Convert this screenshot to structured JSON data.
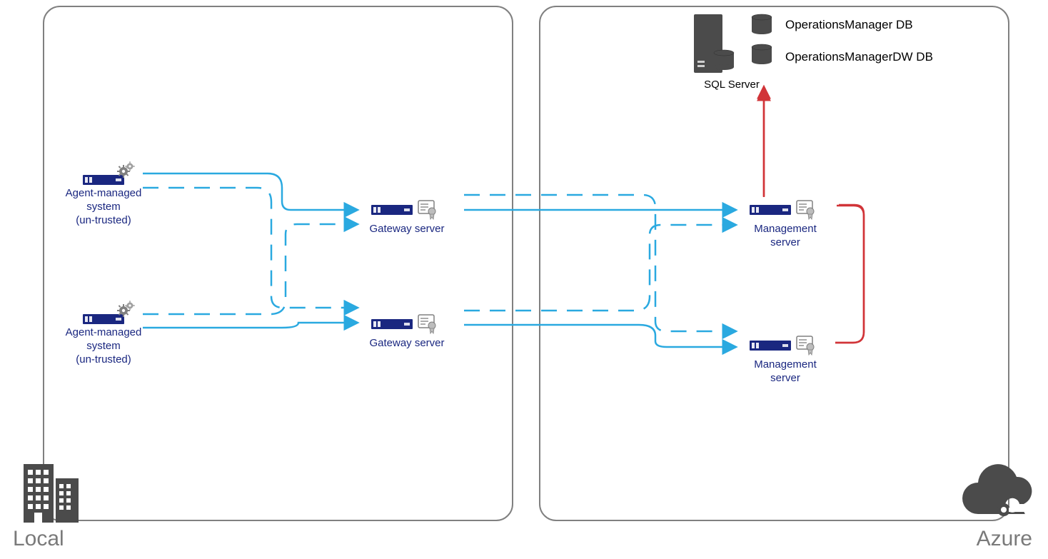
{
  "regions": {
    "local": {
      "label": "Local"
    },
    "azure": {
      "label": "Azure"
    }
  },
  "local_nodes": {
    "agent1": {
      "label": "Agent-managed\nsystem\n(un-trusted)"
    },
    "agent2": {
      "label": "Agent-managed\nsystem\n(un-trusted)"
    },
    "gateway1": {
      "label": "Gateway server"
    },
    "gateway2": {
      "label": "Gateway server"
    }
  },
  "azure_nodes": {
    "mgmt1": {
      "label": "Management\nserver"
    },
    "mgmt2": {
      "label": "Management\nserver"
    },
    "sql": {
      "label": "SQL Server"
    },
    "db1": {
      "label": "OperationsManager DB"
    },
    "db2": {
      "label": "OperationsManagerDW DB"
    }
  },
  "colors": {
    "flow": "#2aa9e0",
    "sql_flow": "#d13438",
    "server": "#1a2780",
    "gray": "#6d6d6d"
  },
  "connections_note": "Agents connect to both Gateway servers (solid=primary, dashed=failover). Gateways connect to both Management servers (solid=primary, dashed=failover). Management servers connect to SQL Server.",
  "diagram_type": "network architecture"
}
